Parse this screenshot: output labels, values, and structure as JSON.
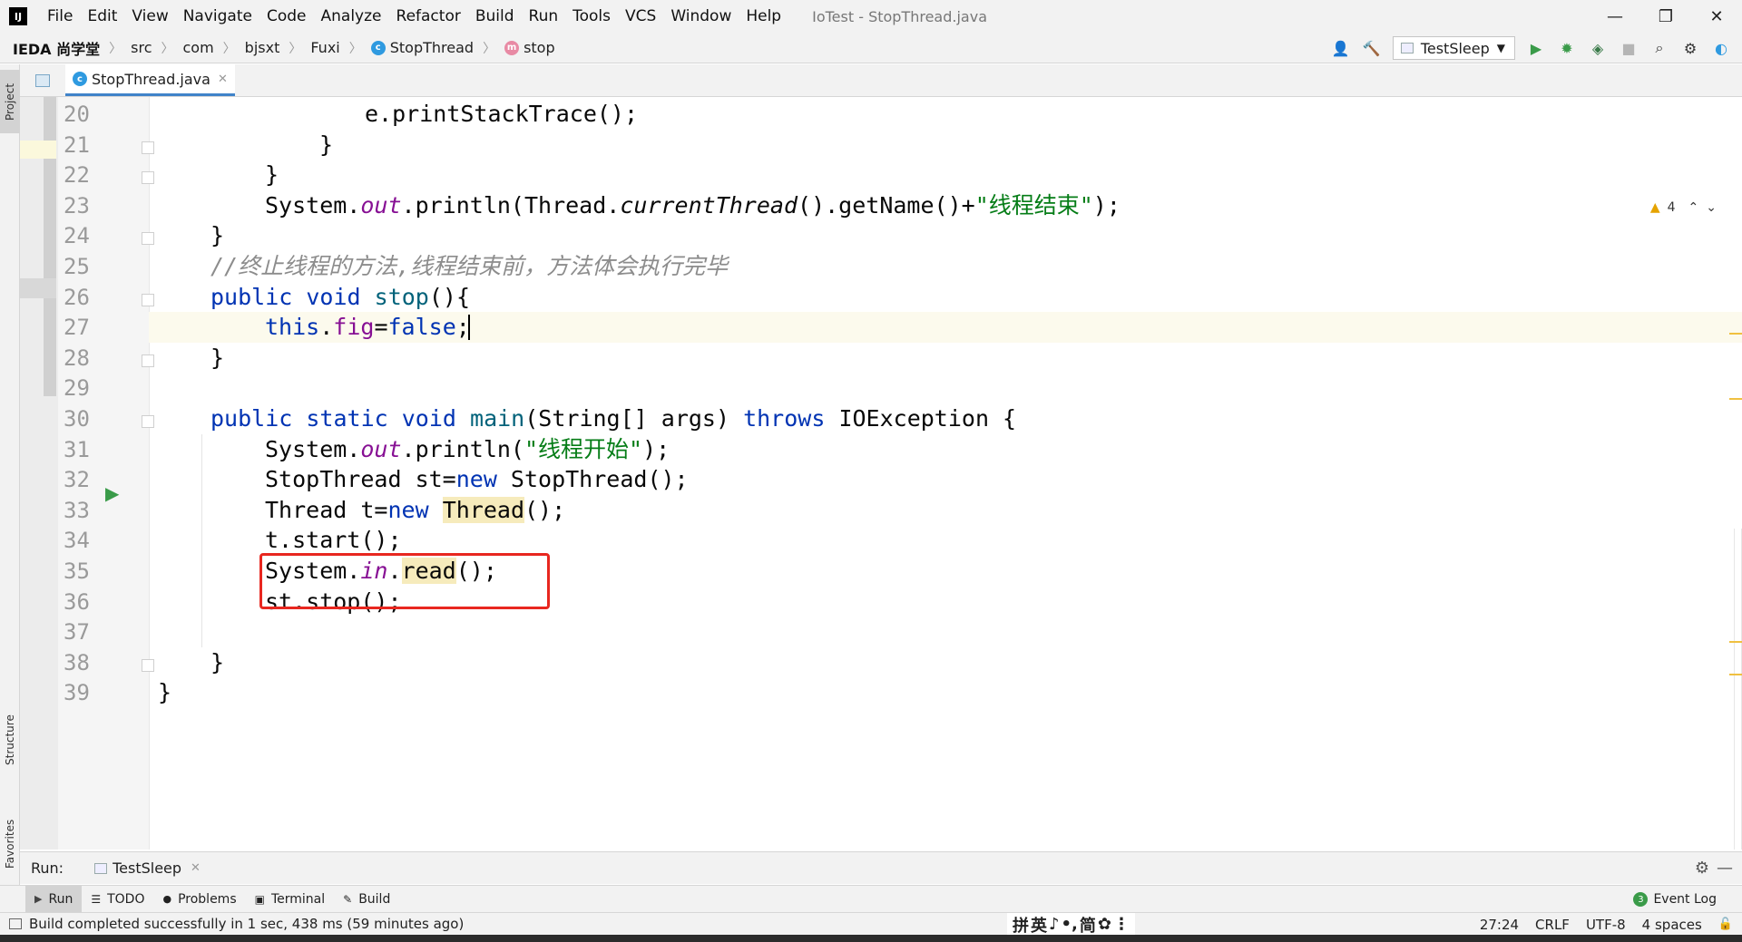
{
  "app": {
    "logo_text": "IJ",
    "window_title": "IoTest - StopThread.java"
  },
  "menu": [
    "File",
    "Edit",
    "View",
    "Navigate",
    "Code",
    "Analyze",
    "Refactor",
    "Build",
    "Run",
    "Tools",
    "VCS",
    "Window",
    "Help"
  ],
  "window_controls": {
    "minimize": "—",
    "maximize": "❐",
    "close": "✕"
  },
  "navbar": {
    "root": "IEDA 尚学堂",
    "crumbs": [
      "src",
      "com",
      "bjsxt",
      "Fuxi",
      "StopThread",
      "stop"
    ],
    "class_icon_letter": "c",
    "method_icon_letter": "m",
    "run_config": "TestSleep"
  },
  "side_tabs": {
    "project": "Project",
    "structure": "Structure",
    "favorites": "Favorites"
  },
  "editor_tab": {
    "label": "StopThread.java",
    "close": "✕"
  },
  "inspections": {
    "warnings": "4"
  },
  "code": {
    "lines": [
      {
        "n": "20",
        "fold": false
      },
      {
        "n": "21",
        "fold": true
      },
      {
        "n": "22",
        "fold": true
      },
      {
        "n": "23",
        "fold": false
      },
      {
        "n": "24",
        "fold": true
      },
      {
        "n": "25",
        "fold": false
      },
      {
        "n": "26",
        "fold": true
      },
      {
        "n": "27",
        "fold": false
      },
      {
        "n": "28",
        "fold": true
      },
      {
        "n": "29",
        "fold": false
      },
      {
        "n": "30",
        "fold": true
      },
      {
        "n": "31",
        "fold": false
      },
      {
        "n": "32",
        "fold": false
      },
      {
        "n": "33",
        "fold": false
      },
      {
        "n": "34",
        "fold": false
      },
      {
        "n": "35",
        "fold": false
      },
      {
        "n": "36",
        "fold": false
      },
      {
        "n": "37",
        "fold": false
      },
      {
        "n": "38",
        "fold": true
      },
      {
        "n": "39",
        "fold": false
      }
    ],
    "t": {
      "l20": "e.printStackTrace();",
      "brace": "}",
      "l23_a": "System.",
      "l23_out": "out",
      "l23_b": ".println(Thread.",
      "l23_ct": "currentThread",
      "l23_c": "().getName()+",
      "l23_str": "\"线程结束\"",
      "l23_d": ");",
      "l25": "//终止线程的方法,线程结束前，方法体会执行完毕",
      "kw_public": "public",
      "kw_void": "void",
      "kw_static": "static",
      "l26_fn": "stop",
      "l26_rest": "(){",
      "kw_this": "this",
      "dot": ".",
      "l27_fld": "fig",
      "eq": "=",
      "kw_false": "false",
      "semi": ";",
      "l30_fn": "main",
      "l30_args": "(String[] args) ",
      "kw_throws": "throws",
      "l30_exc": " IOException {",
      "l31_str": "\"线程开始\"",
      "l31_end": ");",
      "l31_mid": ".println(",
      "l32_a": "StopThread st=",
      "kw_new": "new",
      "l32_b": " StopThread();",
      "l33_a": "Thread t=",
      "l33_cls": "Thread",
      "l33_b": "();",
      "l34": "t.start();",
      "l35_a": "System.",
      "l35_in": "in",
      "l35_read": "read",
      "l35_b": "();",
      "l36": "st.stop();"
    }
  },
  "run_window": {
    "label": "Run:",
    "tab": "TestSleep",
    "close": "✕",
    "gear": "⚙",
    "minimize": "—"
  },
  "tool_tabs": [
    {
      "icon": "▶",
      "label": "Run"
    },
    {
      "icon": "☰",
      "label": "TODO"
    },
    {
      "icon": "●",
      "label": "Problems"
    },
    {
      "icon": "▣",
      "label": "Terminal"
    },
    {
      "icon": "✎",
      "label": "Build"
    }
  ],
  "event_log": {
    "count": "3",
    "label": "Event Log"
  },
  "status": {
    "message": "Build completed successfully in 1 sec, 438 ms (59 minutes ago)",
    "ime": [
      "拼",
      "英",
      "♪",
      "•,",
      "简",
      "✿",
      "⋮"
    ],
    "position": "27:24",
    "line_sep": "CRLF",
    "encoding": "UTF-8",
    "indent": "4 spaces",
    "lock": "🔓"
  },
  "colors": {
    "keyword": "#0033b3",
    "string": "#067d17",
    "field": "#871094",
    "comment": "#8c8c8c",
    "annotation_box": "#e8271f"
  }
}
